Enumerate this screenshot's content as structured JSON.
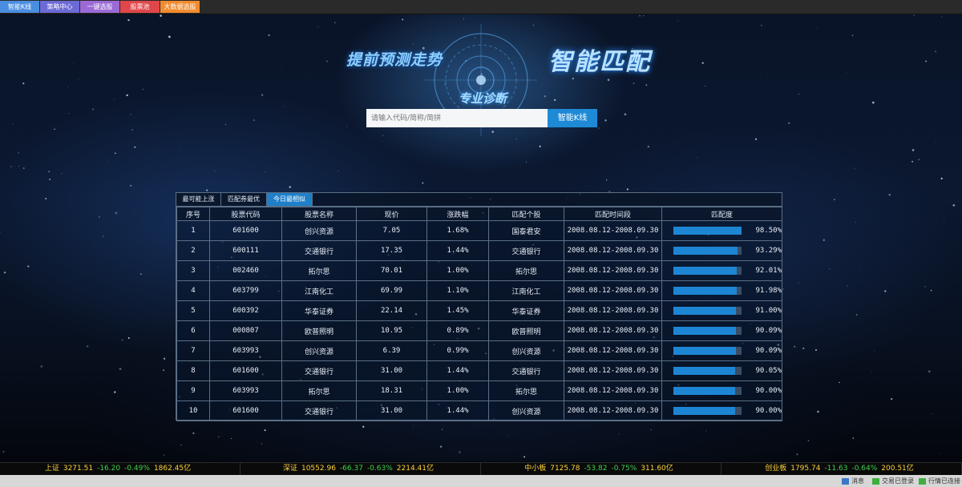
{
  "top_tabs": [
    {
      "label": "智能K线",
      "color": "#4a8ee0"
    },
    {
      "label": "策略中心",
      "color": "#6c6ad6"
    },
    {
      "label": "一键选股",
      "color": "#9b6ad6"
    },
    {
      "label": "股票池",
      "color": "#e0464a"
    },
    {
      "label": "大数据选股",
      "color": "#f28b2e"
    }
  ],
  "hero": {
    "left_text": "提前预测走势",
    "center_text": "专业诊断",
    "right_text": "智能匹配"
  },
  "search": {
    "placeholder": "请输入代码/简称/简拼",
    "button_label": "智能K线"
  },
  "panel": {
    "tabs": [
      "最可能上涨",
      "匹配券最优",
      "今日最相似"
    ],
    "active_tab": 2,
    "headers": [
      "序号",
      "股票代码",
      "股票名称",
      "现价",
      "涨跌幅",
      "匹配个股",
      "匹配时间段",
      "匹配度"
    ],
    "rows": [
      {
        "no": "1",
        "code": "601600",
        "name": "创兴资源",
        "price": "7.05",
        "change": "1.68%",
        "match": "国泰君安",
        "period": "2008.08.12-2008.09.30",
        "score": "98.50%",
        "score_frac": 0.985
      },
      {
        "no": "2",
        "code": "600111",
        "name": "交通银行",
        "price": "17.35",
        "change": "1.44%",
        "match": "交通银行",
        "period": "2008.08.12-2008.09.30",
        "score": "93.29%",
        "score_frac": 0.9329
      },
      {
        "no": "3",
        "code": "002460",
        "name": "拓尔思",
        "price": "70.01",
        "change": "1.00%",
        "match": "拓尔思",
        "period": "2008.08.12-2008.09.30",
        "score": "92.01%",
        "score_frac": 0.9201
      },
      {
        "no": "4",
        "code": "603799",
        "name": "江南化工",
        "price": "69.99",
        "change": "1.10%",
        "match": "江南化工",
        "period": "2008.08.12-2008.09.30",
        "score": "91.98%",
        "score_frac": 0.9198
      },
      {
        "no": "5",
        "code": "600392",
        "name": "华泰证券",
        "price": "22.14",
        "change": "1.45%",
        "match": "华泰证券",
        "period": "2008.08.12-2008.09.30",
        "score": "91.00%",
        "score_frac": 0.91
      },
      {
        "no": "6",
        "code": "000807",
        "name": "欧普照明",
        "price": "10.95",
        "change": "0.89%",
        "match": "欧普照明",
        "period": "2008.08.12-2008.09.30",
        "score": "90.09%",
        "score_frac": 0.9009
      },
      {
        "no": "7",
        "code": "603993",
        "name": "创兴资源",
        "price": "6.39",
        "change": "0.99%",
        "match": "创兴资源",
        "period": "2008.08.12-2008.09.30",
        "score": "90.09%",
        "score_frac": 0.9009
      },
      {
        "no": "8",
        "code": "601600",
        "name": "交通银行",
        "price": "31.00",
        "change": "1.44%",
        "match": "交通银行",
        "period": "2008.08.12-2008.09.30",
        "score": "90.05%",
        "score_frac": 0.9005
      },
      {
        "no": "9",
        "code": "603993",
        "name": "拓尔思",
        "price": "18.31",
        "change": "1.00%",
        "match": "拓尔思",
        "period": "2008.08.12-2008.09.30",
        "score": "90.00%",
        "score_frac": 0.9
      },
      {
        "no": "10",
        "code": "601600",
        "name": "交通银行",
        "price": "31.00",
        "change": "1.44%",
        "match": "创兴资源",
        "period": "2008.08.12-2008.09.30",
        "score": "90.00%",
        "score_frac": 0.9
      }
    ]
  },
  "ticker": [
    {
      "name": "上证",
      "value": "3271.51",
      "chg": "-16.20",
      "pct": "-0.49%",
      "amount": "1862.45亿"
    },
    {
      "name": "深证",
      "value": "10552.96",
      "chg": "-66.37",
      "pct": "-0.63%",
      "amount": "2214.41亿"
    },
    {
      "name": "中小板",
      "value": "7125.78",
      "chg": "-53.82",
      "pct": "-0.75%",
      "amount": "311.60亿"
    },
    {
      "name": "创业板",
      "value": "1795.74",
      "chg": "-11.63",
      "pct": "-0.64%",
      "amount": "200.51亿"
    }
  ],
  "status": {
    "message": "消息",
    "trade": "交易已登录",
    "quote": "行情已连接"
  },
  "colors": {
    "accent": "#1f7fc8",
    "bar_fill": "#1d86d4",
    "bar_track": "#3a4d64",
    "ticker_text": "#ffd23a"
  }
}
